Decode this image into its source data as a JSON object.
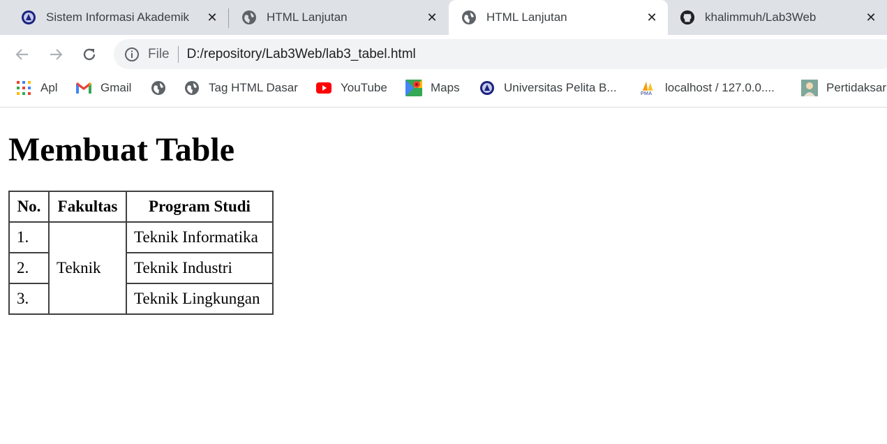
{
  "tabs": [
    {
      "title": "Sistem Informasi Akademik",
      "icon": "university-seal-icon",
      "active": false
    },
    {
      "title": "HTML Lanjutan",
      "icon": "globe-icon",
      "active": false
    },
    {
      "title": "HTML Lanjutan",
      "icon": "globe-icon",
      "active": true
    },
    {
      "title": "khalimmuh/Lab3Web",
      "icon": "github-icon",
      "active": false
    }
  ],
  "toolbar": {
    "file_label": "File",
    "url": "D:/repository/Lab3Web/lab3_tabel.html"
  },
  "bookmarks": [
    {
      "label": "Apl",
      "icon": "apps-grid-icon"
    },
    {
      "label": "Gmail",
      "icon": "gmail-icon"
    },
    {
      "label": "",
      "icon": "globe-icon"
    },
    {
      "label": "Tag HTML Dasar",
      "icon": "globe-icon"
    },
    {
      "label": "YouTube",
      "icon": "youtube-icon"
    },
    {
      "label": "Maps",
      "icon": "maps-icon"
    },
    {
      "label": "Universitas Pelita B...",
      "icon": "university-seal-icon"
    },
    {
      "label": "localhost / 127.0.0....",
      "icon": "phpmyadmin-icon"
    },
    {
      "label": "Pertidaksar",
      "icon": "avatar-icon"
    }
  ],
  "page": {
    "heading": "Membuat Table",
    "table": {
      "headers": [
        "No.",
        "Fakultas",
        "Program Studi"
      ],
      "numbers": [
        "1.",
        "2.",
        "3."
      ],
      "faculty": "Teknik",
      "programs": [
        "Teknik Informatika",
        "Teknik Industri",
        "Teknik Lingkungan"
      ]
    }
  },
  "colors": {
    "tabstrip_bg": "#dee1e6",
    "omnibox_bg": "#f1f3f4",
    "youtube_red": "#ff0000"
  }
}
